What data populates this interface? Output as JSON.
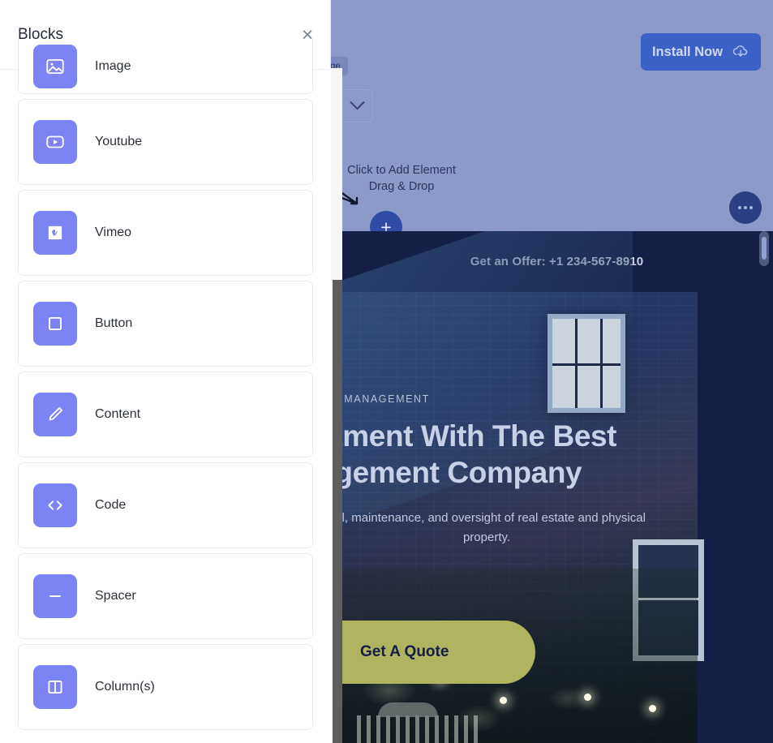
{
  "panel": {
    "title": "Blocks",
    "close_label": "×",
    "close_icon": "close-icon",
    "items": [
      {
        "label": "Image",
        "icon": "image-icon",
        "clipped": true
      },
      {
        "label": "Youtube",
        "icon": "youtube-icon",
        "clipped": false
      },
      {
        "label": "Vimeo",
        "icon": "vimeo-icon",
        "clipped": false
      },
      {
        "label": "Button",
        "icon": "button-icon",
        "clipped": false
      },
      {
        "label": "Content",
        "icon": "pencil-icon",
        "clipped": false
      },
      {
        "label": "Code",
        "icon": "code-icon",
        "clipped": false
      },
      {
        "label": "Spacer",
        "icon": "spacer-icon",
        "clipped": false
      },
      {
        "label": "Column(s)",
        "icon": "columns-icon",
        "clipped": false
      }
    ]
  },
  "canvas": {
    "install_button": "Install Now",
    "install_icon": "cloud-download-icon",
    "page_badge": "ge",
    "dropdown_icon": "chevron-down-icon",
    "add_element_line1": "Click to Add Element",
    "add_element_line2": "Drag & Drop",
    "plus_button": "+",
    "more_button_icon": "ellipsis-icon",
    "hero": {
      "offer": "Get an Offer: +1 234-567-8910",
      "eyebrow": "PERTY MANAGEMENT",
      "title_line1": "estment With The Best",
      "title_line2": "nagement Company",
      "subtitle_line1": "trol, maintenance, and oversight of real estate and physical",
      "subtitle_line2": "property.",
      "cta": "Get A Quote"
    }
  },
  "colors": {
    "tile_purple": "#7c84f5",
    "canvas_bg": "#8d9ac9",
    "hero_navy": "#141e47",
    "install_blue": "#3a62c6",
    "cta_olive": "#b0b35f"
  }
}
